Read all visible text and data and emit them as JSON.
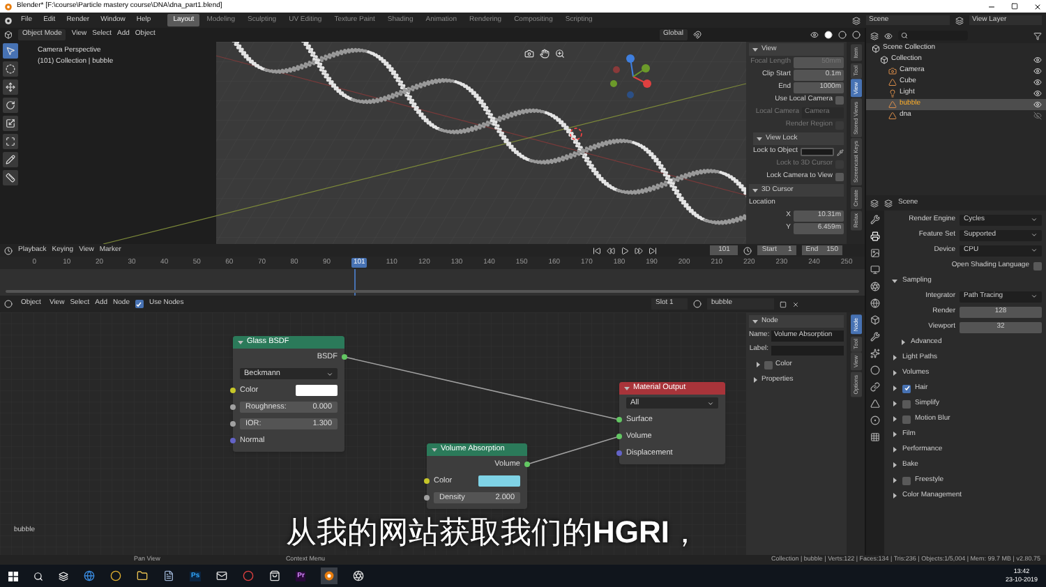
{
  "window": {
    "title": "Blender* [F:\\course\\Particle mastery course\\DNA\\dna_part1.blend]"
  },
  "menu": [
    "File",
    "Edit",
    "Render",
    "Window",
    "Help"
  ],
  "workspace_tabs": [
    {
      "label": "Layout",
      "selected": true
    },
    {
      "label": "Modeling",
      "selected": false
    },
    {
      "label": "Sculpting",
      "selected": false
    },
    {
      "label": "UV Editing",
      "selected": false
    },
    {
      "label": "Texture Paint",
      "selected": false
    },
    {
      "label": "Shading",
      "selected": false
    },
    {
      "label": "Animation",
      "selected": false
    },
    {
      "label": "Rendering",
      "selected": false
    },
    {
      "label": "Compositing",
      "selected": false
    },
    {
      "label": "Scripting",
      "selected": false
    }
  ],
  "scene": "Scene",
  "view_layer": "View Layer",
  "viewport": {
    "mode": "Object Mode",
    "menus": [
      "View",
      "Select",
      "Add",
      "Object"
    ],
    "orientation": "Global",
    "overlay_lines": [
      "Camera Perspective",
      "(101) Collection | bubble"
    ]
  },
  "view_sidebar": {
    "tabs": [
      {
        "label": "Item",
        "selected": false
      },
      {
        "label": "Tool",
        "selected": false
      },
      {
        "label": "View",
        "selected": true
      },
      {
        "label": "Stored Views",
        "selected": false
      },
      {
        "label": "Screencast Keys",
        "selected": false
      },
      {
        "label": "Create",
        "selected": false
      },
      {
        "label": "Relax",
        "selected": false
      }
    ],
    "sections": [
      {
        "title": "View",
        "expanded": true,
        "rows": [
          {
            "kind": "field",
            "label": "Focal Length",
            "value": "50mm",
            "disabled": true
          },
          {
            "kind": "field",
            "label": "Clip Start",
            "value": "0.1m",
            "disabled": false
          },
          {
            "kind": "field",
            "label": "End",
            "value": "1000m",
            "disabled": false
          },
          {
            "kind": "checkbox",
            "label": "Use Local Camera",
            "checked": false,
            "disabled": false
          },
          {
            "kind": "object",
            "label": "Local Camera",
            "value": "Camera",
            "disabled": true
          },
          {
            "kind": "checkbox",
            "label": "Render Region",
            "checked": false,
            "disabled": true
          }
        ]
      },
      {
        "title": "View Lock",
        "expanded": true,
        "rows": [
          {
            "kind": "picker",
            "label": "Lock to Object",
            "disabled": false
          },
          {
            "kind": "checkbox",
            "label": "Lock to 3D Cursor",
            "checked": false,
            "disabled": true
          },
          {
            "kind": "checkbox",
            "label": "Lock Camera to View",
            "checked": false,
            "disabled": false
          }
        ]
      },
      {
        "title": "3D Cursor",
        "expanded": true,
        "rows": [
          {
            "kind": "heading",
            "label": "Location",
            "disabled": false
          },
          {
            "kind": "field",
            "label": "X",
            "value": "10.31m",
            "disabled": false
          },
          {
            "kind": "field",
            "label": "Y",
            "value": "6.459m",
            "disabled": false
          }
        ]
      }
    ]
  },
  "outliner": {
    "items": [
      {
        "label": "Scene Collection",
        "kind": "scene_collection",
        "selected": false,
        "children": [
          {
            "label": "Collection",
            "kind": "collection",
            "selected": false,
            "hidden": false,
            "children": [
              {
                "label": "Camera",
                "kind": "camera",
                "selected": false,
                "hidden": false
              },
              {
                "label": "Cube",
                "kind": "mesh",
                "selected": false,
                "hidden": false
              },
              {
                "label": "Light",
                "kind": "light",
                "selected": false,
                "hidden": false
              },
              {
                "label": "bubble",
                "kind": "mesh",
                "selected": true,
                "hidden": false
              },
              {
                "label": "dna",
                "kind": "mesh",
                "selected": false,
                "hidden": true
              }
            ]
          }
        ]
      }
    ]
  },
  "properties": {
    "title": "Scene",
    "rows": [
      {
        "kind": "select",
        "label": "Render Engine",
        "value": "Cycles"
      },
      {
        "kind": "select",
        "label": "Feature Set",
        "value": "Supported"
      },
      {
        "kind": "select",
        "label": "Device",
        "value": "CPU"
      },
      {
        "kind": "checkbox",
        "label": "Open Shading Language",
        "checked": false
      },
      {
        "kind": "panel",
        "label": "Sampling",
        "expanded": true
      },
      {
        "kind": "select",
        "label": "Integrator",
        "value": "Path Tracing"
      },
      {
        "kind": "number",
        "label": "Render",
        "value": "128"
      },
      {
        "kind": "number",
        "label": "Viewport",
        "value": "32"
      },
      {
        "kind": "subpanel",
        "label": "Advanced",
        "expanded": false
      },
      {
        "kind": "panel",
        "label": "Light Paths",
        "expanded": false
      },
      {
        "kind": "panel",
        "label": "Volumes",
        "expanded": false
      },
      {
        "kind": "panel_check",
        "label": "Hair",
        "checked": true
      },
      {
        "kind": "panel_check",
        "label": "Simplify",
        "checked": false
      },
      {
        "kind": "panel_check",
        "label": "Motion Blur",
        "checked": false
      },
      {
        "kind": "panel",
        "label": "Film",
        "expanded": false
      },
      {
        "kind": "panel",
        "label": "Performance",
        "expanded": false
      },
      {
        "kind": "panel",
        "label": "Bake",
        "expanded": false
      },
      {
        "kind": "panel_check",
        "label": "Freestyle",
        "checked": false
      },
      {
        "kind": "panel",
        "label": "Color Management",
        "expanded": false
      }
    ]
  },
  "timeline": {
    "menus": [
      "Playback",
      "Keying",
      "View",
      "Marker"
    ],
    "current_frame": "101",
    "start_label": "Start",
    "start": "1",
    "end_label": "End",
    "end": "150",
    "ticks": [
      {
        "label": "0",
        "selected": false
      },
      {
        "label": "10",
        "selected": false
      },
      {
        "label": "20",
        "selected": false
      },
      {
        "label": "30",
        "selected": false
      },
      {
        "label": "40",
        "selected": false
      },
      {
        "label": "50",
        "selected": false
      },
      {
        "label": "60",
        "selected": false
      },
      {
        "label": "70",
        "selected": false
      },
      {
        "label": "80",
        "selected": false
      },
      {
        "label": "90",
        "selected": false
      },
      {
        "label": "101",
        "selected": true
      },
      {
        "label": "110",
        "selected": false
      },
      {
        "label": "120",
        "selected": false
      },
      {
        "label": "130",
        "selected": false
      },
      {
        "label": "140",
        "selected": false
      },
      {
        "label": "150",
        "selected": false
      },
      {
        "label": "160",
        "selected": false
      },
      {
        "label": "170",
        "selected": false
      },
      {
        "label": "180",
        "selected": false
      },
      {
        "label": "190",
        "selected": false
      },
      {
        "label": "200",
        "selected": false
      },
      {
        "label": "210",
        "selected": false
      },
      {
        "label": "220",
        "selected": false
      },
      {
        "label": "230",
        "selected": false
      },
      {
        "label": "240",
        "selected": false
      },
      {
        "label": "250",
        "selected": false
      }
    ]
  },
  "node_editor": {
    "object_type": "Object",
    "menus": [
      "View",
      "Select",
      "Add",
      "Node"
    ],
    "use_nodes": {
      "label": "Use Nodes",
      "checked": true
    },
    "slot": "Slot 1",
    "material": "bubble",
    "canvas_label": "bubble",
    "nodes": [
      {
        "title": "Glass BSDF",
        "color": "#2b7a5a",
        "rows": [
          {
            "kind": "output_shader",
            "label": "BSDF"
          },
          {
            "kind": "dropdown",
            "label": "Beckmann"
          },
          {
            "kind": "input_color",
            "label": "Color",
            "color": "#ffffff"
          },
          {
            "kind": "input_number",
            "label": "Roughness:",
            "value": "0.000"
          },
          {
            "kind": "input_number",
            "label": "IOR:",
            "value": "1.300"
          },
          {
            "kind": "input_vector",
            "label": "Normal"
          }
        ]
      },
      {
        "title": "Volume Absorption",
        "color": "#2b7a5a",
        "rows": [
          {
            "kind": "output_shader",
            "label": "Volume"
          },
          {
            "kind": "input_color",
            "label": "Color",
            "color": "#7fd3e6"
          },
          {
            "kind": "input_number",
            "label": "Density",
            "value": "2.000"
          }
        ]
      },
      {
        "title": "Material Output",
        "color": "#a8343a",
        "rows": [
          {
            "kind": "dropdown",
            "label": "All"
          },
          {
            "kind": "input_shader",
            "label": "Surface"
          },
          {
            "kind": "input_shader",
            "label": "Volume"
          },
          {
            "kind": "input_vector",
            "label": "Displacement"
          }
        ]
      }
    ],
    "sidebar": {
      "tabs": [
        {
          "label": "Node",
          "selected": true
        },
        {
          "label": "Tool",
          "selected": false
        },
        {
          "label": "View",
          "selected": false
        },
        {
          "label": "Options",
          "selected": false
        }
      ],
      "section": "Node",
      "name_label": "Name:",
      "name_value": "Volume Absorption",
      "label_label": "Label:",
      "color_panel": {
        "label": "Color",
        "checked": false,
        "expanded": false
      },
      "properties_panel": {
        "label": "Properties",
        "expanded": false
      }
    }
  },
  "subtitle": "从我的网站获取我们的**HGRI**，",
  "status_bar": {
    "hints": [
      "Pan View",
      "Context Menu"
    ],
    "stats": "Collection | bubble | Verts:122 | Faces:134 | Tris:236 | Objects:1/5,004 | Mem: 99.7 MB | v2.80.75"
  },
  "taskbar": {
    "app_badges": [
      "Ps",
      "Pr"
    ],
    "time": "13:42",
    "date": "23-10-2019"
  }
}
